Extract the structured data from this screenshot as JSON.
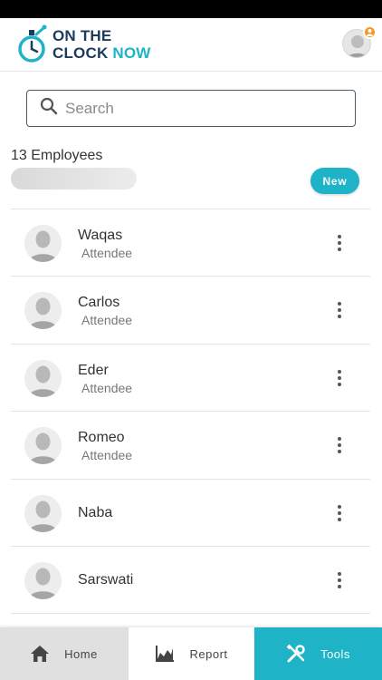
{
  "header": {
    "logo_line1": "ON THE",
    "logo_line2_a": "CLOCK",
    "logo_line2_b": "NOW",
    "brand_color": "#1fb3c8",
    "logo_text_color": "#1d3b5c",
    "badge_color": "#f39a1c"
  },
  "search": {
    "placeholder": "Search",
    "value": ""
  },
  "summary": {
    "employee_count": "13 Employees",
    "new_button_label": "New"
  },
  "employees": [
    {
      "name": "Waqas",
      "role": "Attendee"
    },
    {
      "name": "Carlos",
      "role": "Attendee"
    },
    {
      "name": "Eder",
      "role": "Attendee"
    },
    {
      "name": "Romeo",
      "role": "Attendee"
    },
    {
      "name": "Naba",
      "role": ""
    },
    {
      "name": "Sarswati",
      "role": ""
    }
  ],
  "bottom_nav": {
    "home_label": "Home",
    "report_label": "Report",
    "tools_label": "Tools",
    "active": "Tools",
    "icons": [
      "home-icon",
      "chart-icon",
      "tools-icon"
    ]
  }
}
